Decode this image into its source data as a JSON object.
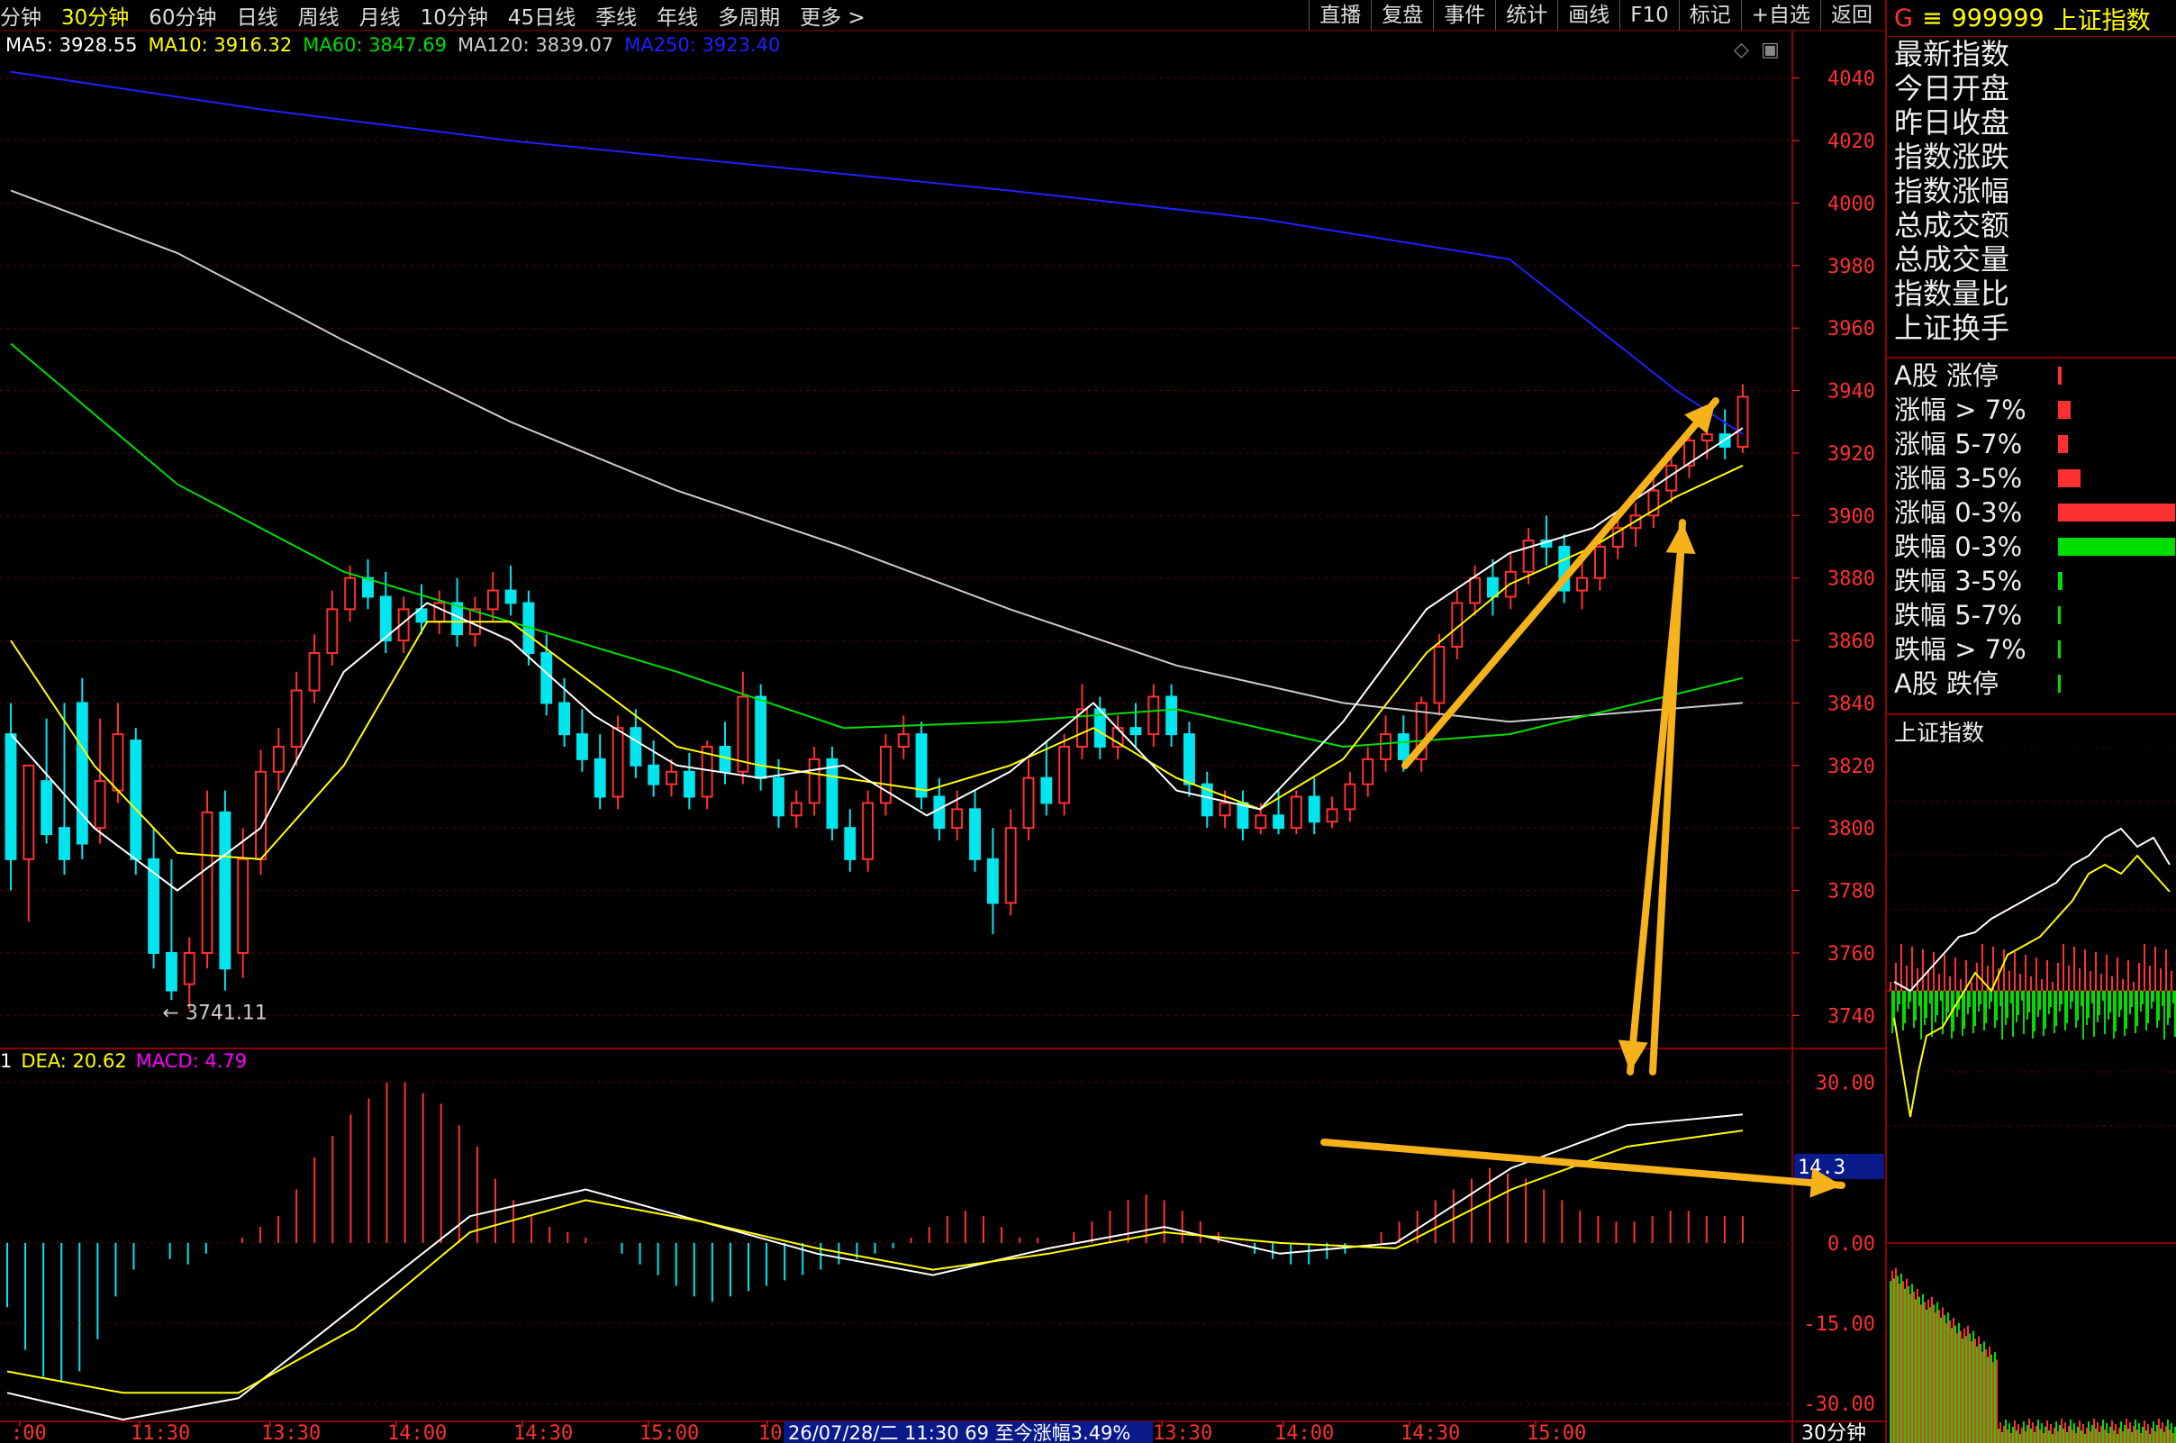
{
  "periods": [
    "分钟",
    "30分钟",
    "60分钟",
    "日线",
    "周线",
    "月线",
    "10分钟",
    "45日线",
    "季线",
    "年线",
    "多周期",
    "更多 >"
  ],
  "active_period_index": 1,
  "tool_buttons": [
    "直播",
    "复盘",
    "事件",
    "统计",
    "画线",
    "F10",
    "标记",
    "+自选",
    "返回"
  ],
  "ma_legend": [
    {
      "label": "MA5: 3928.55",
      "color": "#ffffff"
    },
    {
      "label": "MA10: 3916.32",
      "color": "#ffff00"
    },
    {
      "label": "MA60: 3847.69",
      "color": "#00dd00"
    },
    {
      "label": "MA120: 3839.07",
      "color": "#cccccc"
    },
    {
      "label": "MA250: 3923.40",
      "color": "#2020ff"
    }
  ],
  "macd_legend": [
    {
      "label": "1",
      "color": "#ffffff"
    },
    {
      "label": "DEA: 20.62",
      "color": "#ffff00"
    },
    {
      "label": "MACD: 4.79",
      "color": "#ff00ff"
    }
  ],
  "price_axis": [
    "4040",
    "4020",
    "4000",
    "3980",
    "3960",
    "3940",
    "3920",
    "3900",
    "3880",
    "3860",
    "3840",
    "3820",
    "3800",
    "3780",
    "3760",
    "3740"
  ],
  "macd_axis": [
    "30.00",
    "14.3",
    "0.00",
    "-15.00",
    "-30.00"
  ],
  "time_axis": [
    ":00",
    "11:30",
    "13:30",
    "14:00",
    "14:30",
    "15:00",
    "10:00",
    "13:30",
    "14:00",
    "14:30",
    "15:00"
  ],
  "low_marker": "3741.11",
  "status_info": "26/07/28/二  11:30  69  至今涨幅3.49%",
  "period_label": "30分钟",
  "panel": {
    "code": "999999",
    "name": "上证指数",
    "info_rows": [
      "最新指数",
      "今日开盘",
      "昨日收盘",
      "指数涨跌",
      "指数涨幅",
      "总成交额",
      "总成交量",
      "指数量比",
      "上证换手"
    ],
    "stat_rows": [
      {
        "label": "A股 涨停",
        "color": "#ff3030",
        "bar_fraction": 0.02
      },
      {
        "label": "涨幅 > 7%",
        "color": "#ff3030",
        "bar_fraction": 0.08
      },
      {
        "label": "涨幅 5-7%",
        "color": "#ff3030",
        "bar_fraction": 0.06
      },
      {
        "label": "涨幅 3-5%",
        "color": "#ff3030",
        "bar_fraction": 0.14
      },
      {
        "label": "涨幅 0-3%",
        "color": "#ff3030",
        "bar_fraction": 0.72
      },
      {
        "label": "跌幅 0-3%",
        "color": "#00dd00",
        "bar_fraction": 0.72
      },
      {
        "label": "跌幅 3-5%",
        "color": "#00dd00",
        "bar_fraction": 0.03
      },
      {
        "label": "跌幅 5-7%",
        "color": "#00dd00",
        "bar_fraction": 0.01
      },
      {
        "label": "跌幅 > 7%",
        "color": "#00dd00",
        "bar_fraction": 0.01
      },
      {
        "label": "A股 跌停",
        "color": "#00dd00",
        "bar_fraction": 0.01
      }
    ],
    "mini_title": "上证指数"
  },
  "colors": {
    "up": "#ff3030",
    "down": "#00e5ee",
    "grid": "#8b0000",
    "arrow": "#f5b21a"
  },
  "chart_data": {
    "type": "candlestick",
    "price_range": [
      3730,
      4050
    ],
    "macd_range": [
      -33,
      36
    ],
    "low_label_value": 3741.11,
    "candles": [
      [
        3830,
        3840,
        3790,
        3780
      ],
      [
        3790,
        3810,
        3820,
        3770
      ],
      [
        3815,
        3835,
        3798,
        3795
      ],
      [
        3800,
        3840,
        3790,
        3785
      ],
      [
        3840,
        3848,
        3795,
        3790
      ],
      [
        3800,
        3835,
        3815,
        3795
      ],
      [
        3812,
        3840,
        3830,
        3808
      ],
      [
        3828,
        3832,
        3790,
        3785
      ],
      [
        3790,
        3800,
        3760,
        3755
      ],
      [
        3760,
        3790,
        3748,
        3745
      ],
      [
        3750,
        3765,
        3760,
        3742
      ],
      [
        3760,
        3812,
        3805,
        3755
      ],
      [
        3805,
        3812,
        3755,
        3748
      ],
      [
        3760,
        3800,
        3790,
        3752
      ],
      [
        3790,
        3825,
        3818,
        3785
      ],
      [
        3818,
        3832,
        3826,
        3812
      ],
      [
        3826,
        3850,
        3844,
        3820
      ],
      [
        3844,
        3862,
        3856,
        3840
      ],
      [
        3856,
        3876,
        3870,
        3852
      ],
      [
        3870,
        3884,
        3880,
        3866
      ],
      [
        3880,
        3886,
        3874,
        3870
      ],
      [
        3874,
        3882,
        3860,
        3856
      ],
      [
        3860,
        3874,
        3870,
        3856
      ],
      [
        3870,
        3878,
        3866,
        3862
      ],
      [
        3866,
        3876,
        3872,
        3862
      ],
      [
        3872,
        3880,
        3862,
        3858
      ],
      [
        3862,
        3874,
        3870,
        3858
      ],
      [
        3870,
        3882,
        3876,
        3866
      ],
      [
        3876,
        3884,
        3872,
        3868
      ],
      [
        3872,
        3876,
        3856,
        3852
      ],
      [
        3856,
        3862,
        3840,
        3836
      ],
      [
        3840,
        3848,
        3830,
        3826
      ],
      [
        3830,
        3838,
        3822,
        3818
      ],
      [
        3822,
        3830,
        3810,
        3806
      ],
      [
        3810,
        3836,
        3832,
        3806
      ],
      [
        3832,
        3838,
        3820,
        3816
      ],
      [
        3820,
        3828,
        3814,
        3810
      ],
      [
        3814,
        3822,
        3818,
        3810
      ],
      [
        3818,
        3824,
        3810,
        3806
      ],
      [
        3810,
        3828,
        3826,
        3806
      ],
      [
        3826,
        3834,
        3818,
        3814
      ],
      [
        3818,
        3850,
        3842,
        3814
      ],
      [
        3842,
        3846,
        3816,
        3812
      ],
      [
        3816,
        3822,
        3804,
        3800
      ],
      [
        3804,
        3812,
        3808,
        3800
      ],
      [
        3808,
        3826,
        3822,
        3804
      ],
      [
        3822,
        3826,
        3800,
        3796
      ],
      [
        3800,
        3806,
        3790,
        3786
      ],
      [
        3790,
        3812,
        3808,
        3786
      ],
      [
        3808,
        3830,
        3826,
        3804
      ],
      [
        3826,
        3836,
        3830,
        3822
      ],
      [
        3830,
        3834,
        3810,
        3806
      ],
      [
        3810,
        3816,
        3800,
        3796
      ],
      [
        3800,
        3812,
        3806,
        3796
      ],
      [
        3806,
        3812,
        3790,
        3786
      ],
      [
        3790,
        3800,
        3776,
        3766
      ],
      [
        3776,
        3806,
        3800,
        3772
      ],
      [
        3800,
        3822,
        3816,
        3796
      ],
      [
        3816,
        3828,
        3808,
        3804
      ],
      [
        3808,
        3830,
        3826,
        3804
      ],
      [
        3826,
        3846,
        3838,
        3822
      ],
      [
        3838,
        3842,
        3826,
        3822
      ],
      [
        3826,
        3836,
        3832,
        3822
      ],
      [
        3832,
        3840,
        3830,
        3826
      ],
      [
        3830,
        3846,
        3842,
        3826
      ],
      [
        3842,
        3846,
        3830,
        3826
      ],
      [
        3830,
        3834,
        3814,
        3810
      ],
      [
        3814,
        3818,
        3804,
        3800
      ],
      [
        3804,
        3812,
        3808,
        3800
      ],
      [
        3808,
        3812,
        3800,
        3796
      ],
      [
        3800,
        3808,
        3804,
        3798
      ],
      [
        3804,
        3812,
        3800,
        3798
      ],
      [
        3800,
        3812,
        3810,
        3798
      ],
      [
        3810,
        3816,
        3802,
        3798
      ],
      [
        3802,
        3810,
        3806,
        3800
      ],
      [
        3806,
        3818,
        3814,
        3802
      ],
      [
        3814,
        3826,
        3822,
        3810
      ],
      [
        3822,
        3836,
        3830,
        3818
      ],
      [
        3830,
        3836,
        3822,
        3818
      ],
      [
        3822,
        3842,
        3840,
        3818
      ],
      [
        3840,
        3862,
        3858,
        3836
      ],
      [
        3858,
        3876,
        3872,
        3854
      ],
      [
        3872,
        3884,
        3880,
        3868
      ],
      [
        3880,
        3886,
        3874,
        3868
      ],
      [
        3874,
        3888,
        3882,
        3870
      ],
      [
        3882,
        3896,
        3892,
        3878
      ],
      [
        3892,
        3900,
        3890,
        3884
      ],
      [
        3890,
        3894,
        3876,
        3872
      ],
      [
        3876,
        3886,
        3880,
        3870
      ],
      [
        3880,
        3894,
        3890,
        3876
      ],
      [
        3890,
        3900,
        3896,
        3886
      ],
      [
        3896,
        3904,
        3900,
        3890
      ],
      [
        3900,
        3912,
        3908,
        3896
      ],
      [
        3908,
        3920,
        3916,
        3904
      ],
      [
        3916,
        3928,
        3924,
        3912
      ],
      [
        3924,
        3932,
        3926,
        3918
      ],
      [
        3926,
        3934,
        3922,
        3918
      ],
      [
        3922,
        3942,
        3938,
        3920
      ]
    ],
    "series": [
      {
        "name": "MA250",
        "color": "#2020ff",
        "points": [
          [
            0,
            4042
          ],
          [
            15,
            4030
          ],
          [
            30,
            4020
          ],
          [
            45,
            4012
          ],
          [
            60,
            4004
          ],
          [
            75,
            3995
          ],
          [
            90,
            3982
          ],
          [
            100,
            3940
          ],
          [
            104,
            3926
          ]
        ]
      },
      {
        "name": "MA120",
        "color": "#cccccc",
        "points": [
          [
            0,
            4004
          ],
          [
            10,
            3984
          ],
          [
            20,
            3956
          ],
          [
            30,
            3930
          ],
          [
            40,
            3908
          ],
          [
            50,
            3890
          ],
          [
            60,
            3870
          ],
          [
            70,
            3852
          ],
          [
            80,
            3840
          ],
          [
            90,
            3834
          ],
          [
            104,
            3840
          ]
        ]
      },
      {
        "name": "MA60",
        "color": "#00dd00",
        "points": [
          [
            0,
            3955
          ],
          [
            10,
            3910
          ],
          [
            20,
            3882
          ],
          [
            30,
            3866
          ],
          [
            40,
            3850
          ],
          [
            50,
            3832
          ],
          [
            60,
            3834
          ],
          [
            70,
            3838
          ],
          [
            80,
            3826
          ],
          [
            90,
            3830
          ],
          [
            104,
            3848
          ]
        ]
      },
      {
        "name": "MA10",
        "color": "#ffff00",
        "points": [
          [
            0,
            3860
          ],
          [
            5,
            3820
          ],
          [
            10,
            3792
          ],
          [
            15,
            3790
          ],
          [
            20,
            3820
          ],
          [
            25,
            3866
          ],
          [
            30,
            3866
          ],
          [
            35,
            3846
          ],
          [
            40,
            3826
          ],
          [
            45,
            3820
          ],
          [
            50,
            3816
          ],
          [
            55,
            3812
          ],
          [
            60,
            3820
          ],
          [
            65,
            3832
          ],
          [
            70,
            3816
          ],
          [
            75,
            3806
          ],
          [
            80,
            3822
          ],
          [
            85,
            3856
          ],
          [
            90,
            3878
          ],
          [
            95,
            3890
          ],
          [
            100,
            3906
          ],
          [
            104,
            3916
          ]
        ]
      },
      {
        "name": "MA5",
        "color": "#ffffff",
        "points": [
          [
            0,
            3830
          ],
          [
            5,
            3800
          ],
          [
            10,
            3780
          ],
          [
            15,
            3800
          ],
          [
            20,
            3850
          ],
          [
            25,
            3872
          ],
          [
            30,
            3860
          ],
          [
            35,
            3836
          ],
          [
            40,
            3820
          ],
          [
            45,
            3816
          ],
          [
            50,
            3820
          ],
          [
            55,
            3804
          ],
          [
            60,
            3818
          ],
          [
            65,
            3840
          ],
          [
            70,
            3812
          ],
          [
            75,
            3806
          ],
          [
            80,
            3834
          ],
          [
            85,
            3870
          ],
          [
            90,
            3888
          ],
          [
            95,
            3896
          ],
          [
            100,
            3914
          ],
          [
            104,
            3928
          ]
        ]
      }
    ],
    "macd_hist": [
      -12,
      -20,
      -25,
      -26,
      -24,
      -18,
      -10,
      -5,
      0,
      -3,
      -4,
      -2,
      0,
      1,
      3,
      5,
      10,
      16,
      20,
      24,
      27,
      30,
      30,
      28,
      26,
      22,
      18,
      12,
      8,
      5,
      3,
      2,
      1,
      0,
      -2,
      -4,
      -6,
      -8,
      -10,
      -11,
      -10,
      -9,
      -8,
      -7,
      -6,
      -5,
      -4,
      -3,
      -2,
      -1,
      1,
      3,
      5,
      6,
      5,
      3,
      1,
      1,
      0,
      2,
      4,
      6,
      8,
      9,
      8,
      6,
      4,
      2,
      0,
      -2,
      -3,
      -4,
      -4,
      -3,
      -2,
      0,
      2,
      4,
      6,
      8,
      10,
      12,
      14,
      13,
      12,
      10,
      8,
      6,
      5,
      4,
      4,
      5,
      6,
      6,
      5,
      5,
      5
    ],
    "dif": [
      [
        0,
        -28
      ],
      [
        8,
        -33
      ],
      [
        16,
        -29
      ],
      [
        24,
        -12
      ],
      [
        32,
        5
      ],
      [
        40,
        10
      ],
      [
        48,
        4
      ],
      [
        56,
        -2
      ],
      [
        64,
        -6
      ],
      [
        72,
        -1
      ],
      [
        80,
        3
      ],
      [
        88,
        -2
      ],
      [
        96,
        0
      ],
      [
        104,
        14
      ],
      [
        112,
        22
      ],
      [
        120,
        24
      ]
    ],
    "dea": [
      [
        0,
        -24
      ],
      [
        8,
        -28
      ],
      [
        16,
        -28
      ],
      [
        24,
        -16
      ],
      [
        32,
        2
      ],
      [
        40,
        8
      ],
      [
        48,
        4
      ],
      [
        56,
        -1
      ],
      [
        64,
        -5
      ],
      [
        72,
        -2
      ],
      [
        80,
        2
      ],
      [
        88,
        0
      ],
      [
        96,
        -1
      ],
      [
        104,
        10
      ],
      [
        112,
        18
      ],
      [
        120,
        21
      ]
    ],
    "mini_line": [
      [
        0,
        200
      ],
      [
        10,
        210
      ],
      [
        20,
        190
      ],
      [
        30,
        170
      ],
      [
        40,
        150
      ],
      [
        50,
        145
      ],
      [
        60,
        130
      ],
      [
        70,
        120
      ],
      [
        80,
        110
      ],
      [
        90,
        100
      ],
      [
        100,
        90
      ],
      [
        110,
        70
      ],
      [
        120,
        60
      ],
      [
        130,
        40
      ],
      [
        140,
        30
      ],
      [
        150,
        50
      ],
      [
        160,
        40
      ],
      [
        170,
        70
      ]
    ],
    "mini_line2": [
      [
        0,
        220
      ],
      [
        10,
        330
      ],
      [
        15,
        280
      ],
      [
        20,
        240
      ],
      [
        30,
        230
      ],
      [
        40,
        200
      ],
      [
        50,
        170
      ],
      [
        60,
        190
      ],
      [
        70,
        150
      ],
      [
        80,
        140
      ],
      [
        90,
        130
      ],
      [
        100,
        110
      ],
      [
        110,
        90
      ],
      [
        120,
        60
      ],
      [
        130,
        50
      ],
      [
        140,
        60
      ],
      [
        150,
        40
      ],
      [
        160,
        60
      ],
      [
        170,
        80
      ]
    ]
  }
}
